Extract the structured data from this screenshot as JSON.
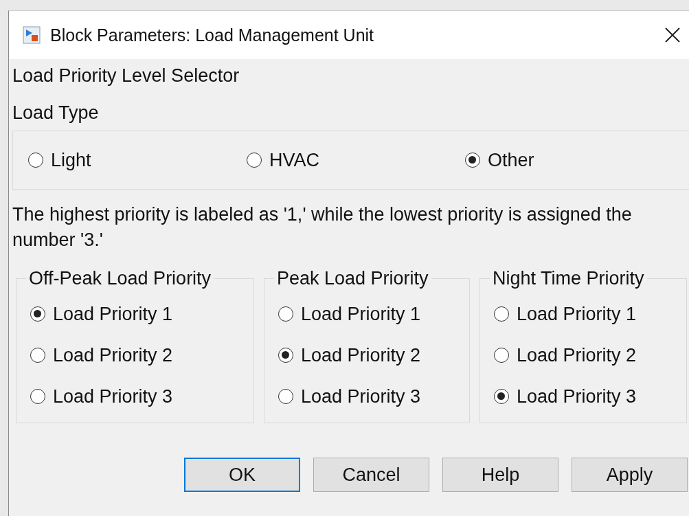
{
  "window": {
    "title": "Block Parameters: Load Management Unit"
  },
  "heading": "Load Priority Level Selector",
  "load_type": {
    "label": "Load Type",
    "options": [
      {
        "label": "Light",
        "selected": false
      },
      {
        "label": "HVAC",
        "selected": false
      },
      {
        "label": "Other",
        "selected": true
      }
    ]
  },
  "note": "The highest priority is labeled as '1,' while the lowest priority is assigned the number '3.'",
  "priority_groups": [
    {
      "title": "Off-Peak Load Priority",
      "options": [
        {
          "label": "Load Priority 1",
          "selected": true
        },
        {
          "label": "Load Priority 2",
          "selected": false
        },
        {
          "label": "Load Priority 3",
          "selected": false
        }
      ]
    },
    {
      "title": "Peak Load Priority",
      "options": [
        {
          "label": "Load Priority 1",
          "selected": false
        },
        {
          "label": "Load Priority 2",
          "selected": true
        },
        {
          "label": "Load Priority 3",
          "selected": false
        }
      ]
    },
    {
      "title": "Night Time Priority",
      "options": [
        {
          "label": "Load Priority 1",
          "selected": false
        },
        {
          "label": "Load Priority 2",
          "selected": false
        },
        {
          "label": "Load Priority 3",
          "selected": true
        }
      ]
    }
  ],
  "buttons": [
    {
      "label": "OK",
      "default": true
    },
    {
      "label": "Cancel",
      "default": false
    },
    {
      "label": "Help",
      "default": false
    },
    {
      "label": "Apply",
      "default": false
    }
  ]
}
